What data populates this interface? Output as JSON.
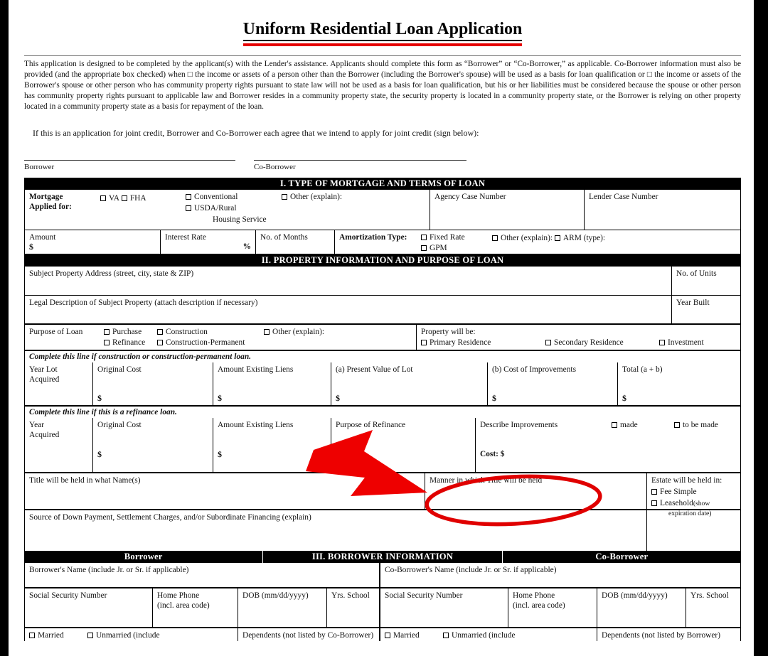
{
  "document": {
    "title": "Uniform Residential Loan Application",
    "intro": "This application is designed to be completed by the applicant(s) with the Lender's assistance. Applicants should complete this form as “Borrower” or “Co-Borrower,” as applicable. Co-Borrower information must also be provided (and the appropriate box checked) when □ the income or assets of a person other than the Borrower (including the Borrower's spouse) will be used as a basis for loan qualification or □ the income or assets of the Borrower's spouse or other person who has community property rights pursuant to state law will not be used as a basis for loan qualification, but his or her liabilities must be considered because the spouse or other person has community property rights pursuant to applicable law and Borrower resides in a community property state, the security property is located in a community property state, or the Borrower is relying on other property located in a community property state as a basis for repayment of the loan.",
    "joint_credit": "If this is an application for joint credit, Borrower and Co-Borrower each agree that we intend to apply for joint credit (sign below):",
    "signature_borrower": "Borrower",
    "signature_coborrower": "Co-Borrower"
  },
  "section1": {
    "heading": "I. TYPE OF MORTGAGE AND TERMS OF LOAN",
    "mortgage_applied_line1": "Mortgage",
    "mortgage_applied_line2": "Applied for:",
    "opt_va": "VA",
    "opt_fha": "FHA",
    "opt_conventional": "Conventional",
    "opt_usda": "USDA/Rural",
    "opt_usda_line2": "Housing Service",
    "opt_other": "Other (explain):",
    "agency_case_number": "Agency Case Number",
    "lender_case_number": "Lender Case Number",
    "amount": "Amount",
    "amount_symbol": "$",
    "interest_rate": "Interest Rate",
    "percent_symbol": "%",
    "no_of_months": "No. of Months",
    "amortization_type": "Amortization Type:",
    "amort_fixed": "Fixed Rate",
    "amort_gpm": "GPM",
    "amort_other": "Other (explain):",
    "amort_arm": "ARM (type):"
  },
  "section2": {
    "heading": "II. PROPERTY INFORMATION AND PURPOSE OF LOAN",
    "subject_property_address": "Subject Property Address (street, city, state & ZIP)",
    "no_of_units": "No. of Units",
    "legal_description": "Legal Description of Subject Property (attach description if necessary)",
    "year_built": "Year Built",
    "purpose_of_loan": "Purpose of Loan",
    "purpose_purchase": "Purchase",
    "purpose_refinance": "Refinance",
    "purpose_construction": "Construction",
    "purpose_construction_perm": "Construction-Permanent",
    "purpose_other": "Other (explain):",
    "property_will_be": "Property will be:",
    "prop_primary": "Primary Residence",
    "prop_secondary": "Secondary Residence",
    "prop_investment": "Investment",
    "construction_note": "Complete this line if construction or construction-permanent loan.",
    "year_lot_acquired_l1": "Year Lot",
    "year_lot_acquired_l2": "Acquired",
    "original_cost": "Original Cost",
    "amount_existing_liens": "Amount Existing Liens",
    "present_value_of_lot": "(a) Present Value of Lot",
    "cost_of_improvements": "(b) Cost of Improvements",
    "total_a_b": "Total (a + b)",
    "refinance_note": "Complete this line if this is a refinance loan.",
    "year_acquired_l1": "Year",
    "year_acquired_l2": "Acquired",
    "purpose_of_refinance": "Purpose of Refinance",
    "describe_improvements": "Describe Improvements",
    "improv_made": "made",
    "improv_to_be_made": "to be made",
    "cost_label": "Cost: $",
    "title_held_names": "Title will be held in what Name(s)",
    "manner_title_held": "Manner in which Title will be held",
    "estate_held_in": "Estate will be held in:",
    "estate_fee_simple": "Fee Simple",
    "estate_leasehold": "Leasehold",
    "estate_leasehold_note": "(show",
    "estate_leasehold_note2": "expiration date)",
    "source_down_payment": "Source of Down Payment, Settlement Charges, and/or Subordinate Financing (explain)",
    "dollar": "$"
  },
  "section3": {
    "heading": "III. BORROWER INFORMATION",
    "borrower": "Borrower",
    "coborrower": "Co-Borrower",
    "borrower_name": "Borrower's Name (include Jr. or Sr. if applicable)",
    "coborrower_name": "Co-Borrower's Name (include Jr. or Sr. if applicable)",
    "ssn": "Social Security Number",
    "home_phone_l1": "Home Phone",
    "home_phone_l2": "(incl. area code)",
    "dob": "DOB (mm/dd/yyyy)",
    "yrs_school": "Yrs. School",
    "married": "Married",
    "unmarried": "Unmarried (include",
    "dependents_co": "Dependents (not listed by Co-Borrower)",
    "dependents_bo": "Dependents (not listed by Borrower)"
  },
  "annotations": {
    "arrow_color": "#ee0000",
    "ellipse_color": "#e00000",
    "arrow_target": "Manner in which Title will be held",
    "title_underline_color": "#e60000"
  }
}
